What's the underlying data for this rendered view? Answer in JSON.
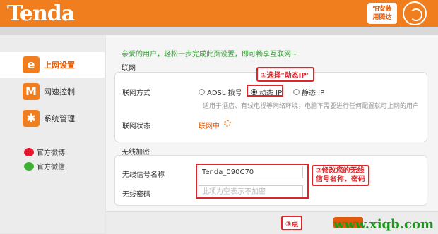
{
  "header": {
    "logo": "Tenda",
    "badge_line1": "怕安装",
    "badge_line2": "用腾达"
  },
  "sidebar": {
    "items": [
      {
        "label": "上网设置",
        "icon": "e"
      },
      {
        "label": "网速控制",
        "icon": "M"
      },
      {
        "label": "系统管理",
        "icon": "✱"
      }
    ],
    "social": [
      {
        "label": "官方微博"
      },
      {
        "label": "官方微信"
      }
    ]
  },
  "main": {
    "welcome": "亲爱的用户，轻松一步完成此页设置，即可畅享互联网~",
    "network_section": "联网",
    "connection_type_label": "联网方式",
    "connection_options": [
      "ADSL 拨号",
      "动态 IP",
      "静态 IP"
    ],
    "selected_option": "动态 IP",
    "hint": "适用于酒店、有线电视等网络环境，电脑不需要进行任何配置就可上网的用户",
    "status_label": "联网状态",
    "status_value": "联网中",
    "wireless_section": "无线加密",
    "ssid_label": "无线信号名称",
    "ssid_value": "Tenda_090C70",
    "password_label": "无线密码",
    "password_placeholder": "此项为空表示不加密"
  },
  "annotations": {
    "step1": "①选择\"动态IP\"",
    "step2_line1": "②修改您的无线",
    "step2_line2": "信号名称、密码",
    "step3": "③点"
  },
  "watermark": "www.xiqb.com",
  "colors": {
    "brand": "#f07d1e",
    "annotation": "#e0262a",
    "welcome": "#3a9a3a"
  }
}
